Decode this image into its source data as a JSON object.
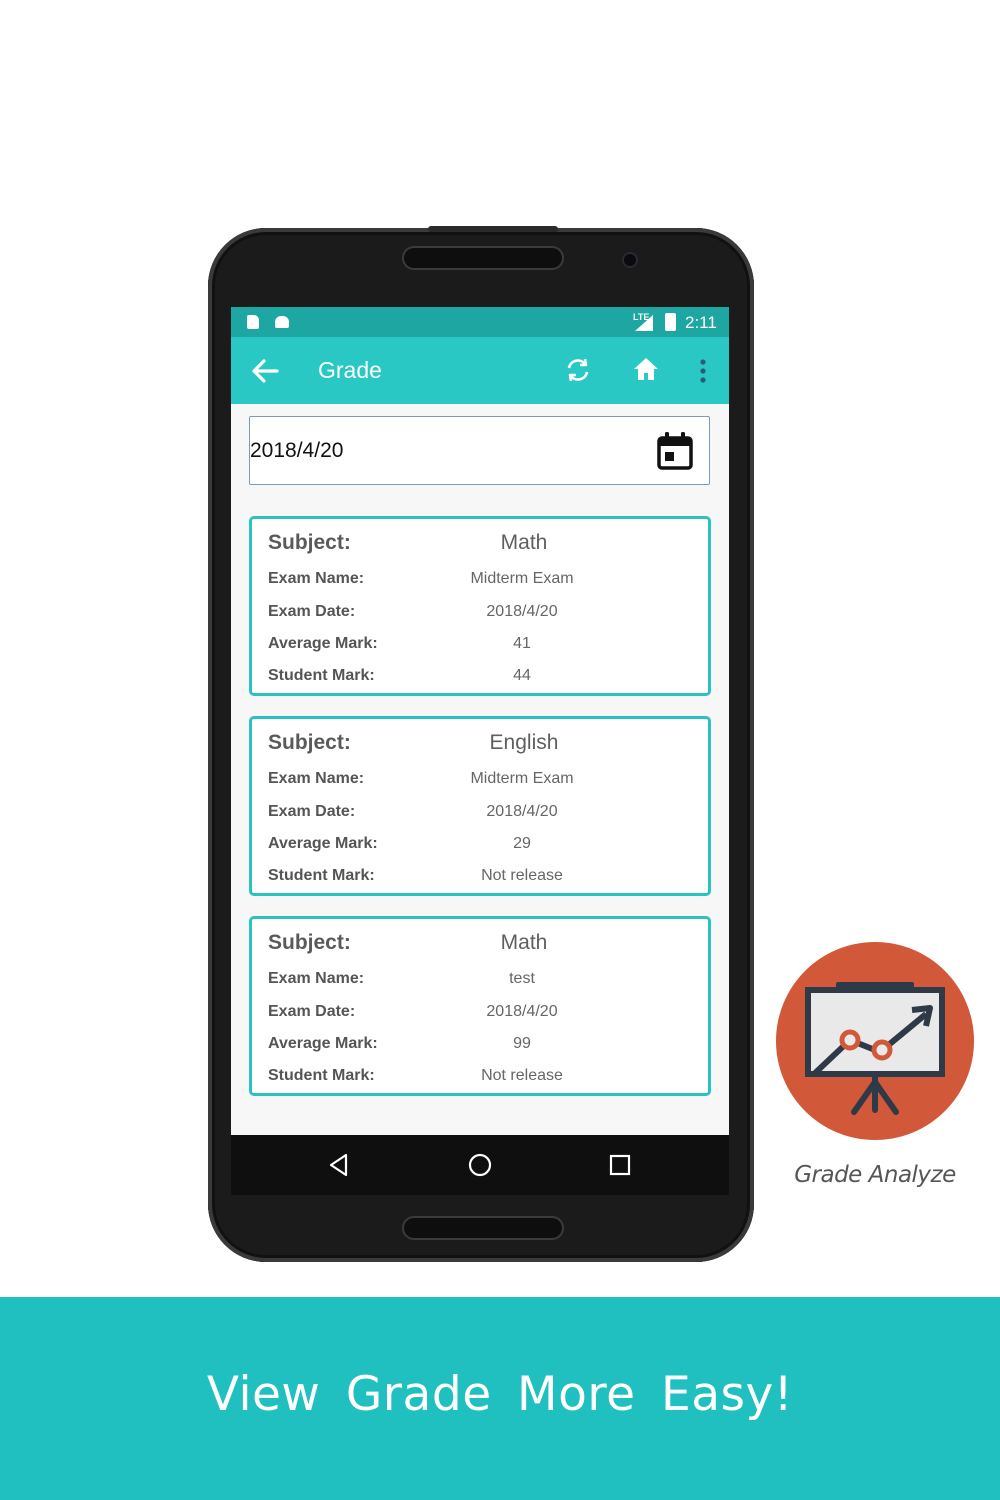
{
  "status_bar": {
    "network": "LTE",
    "time": "2:11"
  },
  "app_bar": {
    "title": "Grade",
    "icons": [
      "back-arrow-icon",
      "refresh-icon",
      "home-icon",
      "more-vert-icon"
    ]
  },
  "date_field": {
    "value": "2018/4/20",
    "icon": "calendar-icon"
  },
  "labels": {
    "subject": "Subject:",
    "exam_name": "Exam Name:",
    "exam_date": "Exam Date:",
    "average_mark": "Average Mark:",
    "student_mark": "Student Mark:"
  },
  "grades": [
    {
      "subject": "Math",
      "exam_name": "Midterm Exam",
      "exam_date": "2018/4/20",
      "average_mark": "41",
      "student_mark": "44"
    },
    {
      "subject": "English",
      "exam_name": "Midterm Exam",
      "exam_date": "2018/4/20",
      "average_mark": "29",
      "student_mark": "Not release"
    },
    {
      "subject": "Math",
      "exam_name": "test",
      "exam_date": "2018/4/20",
      "average_mark": "99",
      "student_mark": "Not release"
    }
  ],
  "logo": {
    "caption": "Grade Analyze",
    "colors": {
      "circle": "#d2583a",
      "board": "#e9e9e9",
      "frame": "#2e3a48",
      "points": "#d2583a"
    }
  },
  "banner": {
    "text": "View Grade More Easy!"
  },
  "colors": {
    "status_bar": "#1ea7a2",
    "app_bar": "#2ac8c4",
    "card_border": "#2bc3c0",
    "banner": "#20bfc0"
  }
}
